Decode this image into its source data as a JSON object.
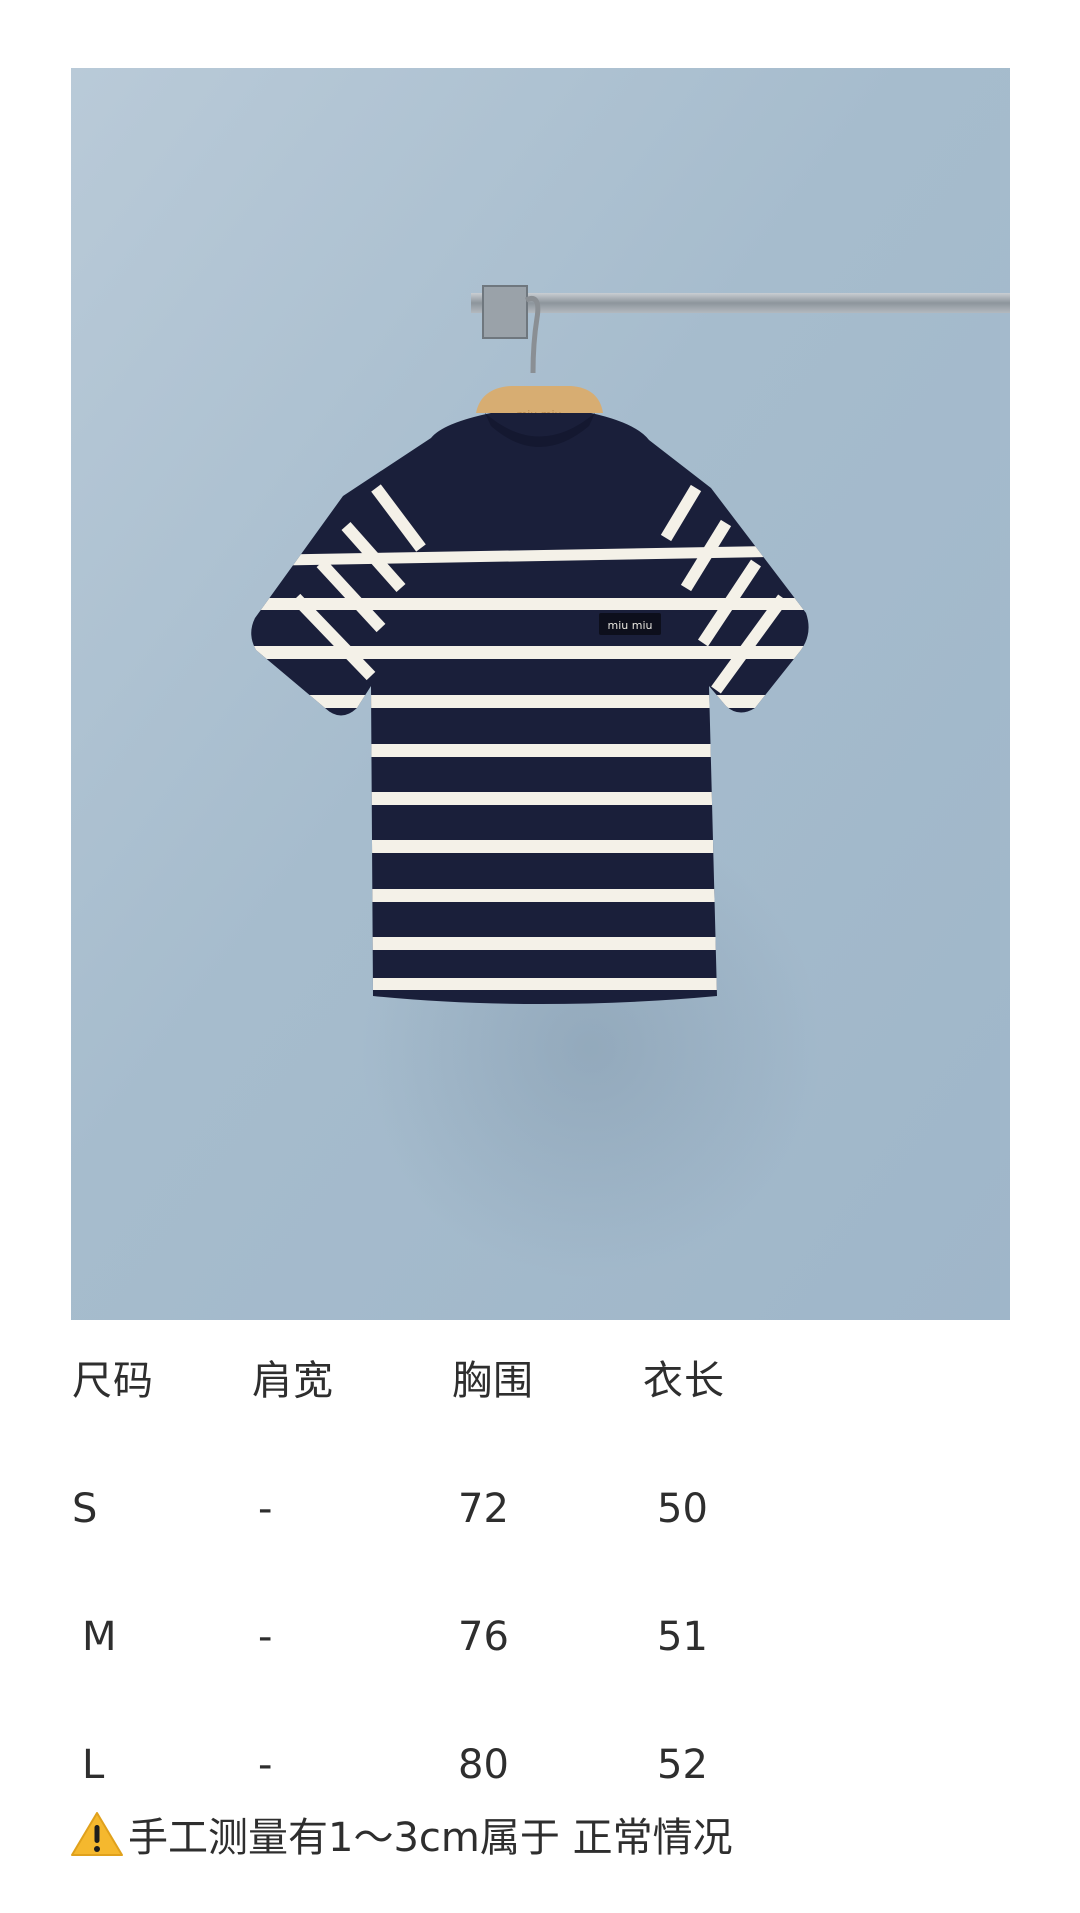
{
  "product": {
    "photo_label": "miu miu"
  },
  "size_table": {
    "headers": [
      "尺码",
      "肩宽",
      "胸围",
      "衣长"
    ],
    "rows": [
      [
        "S",
        "-",
        "72",
        "50"
      ],
      [
        "M",
        "-",
        "76",
        "51"
      ],
      [
        "L",
        "-",
        "80",
        "52"
      ]
    ]
  },
  "note": {
    "icon": "warning-icon",
    "text": "手工测量有1～3cm属于 正常情况"
  },
  "colors": {
    "wall": "#a9bfd0",
    "shirt_navy": "#1a1f3a",
    "stripe": "#f4f1e8",
    "hanger": "#d7ad72"
  }
}
